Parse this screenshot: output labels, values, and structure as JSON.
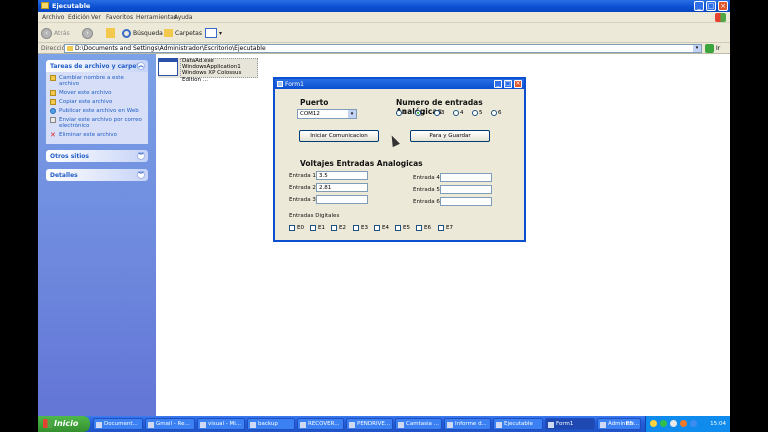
{
  "window": {
    "title": "Ejecutable"
  },
  "menu": [
    "Archivo",
    "Edición",
    "Ver",
    "Favoritos",
    "Herramientas",
    "Ayuda"
  ],
  "toolbar": {
    "back": "Atrás",
    "search": "Búsqueda",
    "folders": "Carpetas"
  },
  "address": {
    "label": "Dirección",
    "value": "D:\\Documents and Settings\\Administrador\\Escritorio\\Ejecutable",
    "go": "Ir"
  },
  "sidebar": {
    "tasks": {
      "title": "Tareas de archivo y carpeta",
      "items": [
        {
          "label": "Cambiar nombre a este archivo",
          "icon": "rename-icon"
        },
        {
          "label": "Mover este archivo",
          "icon": "move-icon"
        },
        {
          "label": "Copiar este archivo",
          "icon": "copy-icon"
        },
        {
          "label": "Publicar este archivo en Web",
          "icon": "web-icon"
        },
        {
          "label": "Enviar este archivo por correo electrónico",
          "icon": "mail-icon"
        },
        {
          "label": "Eliminar este archivo",
          "icon": "delete-icon"
        }
      ]
    },
    "other": {
      "title": "Otros sitios"
    },
    "details": {
      "title": "Detalles"
    }
  },
  "file": {
    "name": "DataAd.exe",
    "desc": "WindowsApplication1",
    "company": "Windows XP Colossus Edition ..."
  },
  "form": {
    "title": "Form1",
    "port_label": "Puerto",
    "port_value": "COM12",
    "analog_label": "Numero de entradas Analógicas",
    "radios": [
      "1",
      "2",
      "3",
      "4",
      "5",
      "6"
    ],
    "radio_selected": "2",
    "start_button": "Iniciar Comunicacion",
    "stop_button": "Para y Guardar",
    "voltages_label": "Voltajes Entradas Analogicas",
    "inputs": [
      {
        "label": "Entrada 1",
        "value": "3.5"
      },
      {
        "label": "Entrada 2",
        "value": "2.81"
      },
      {
        "label": "Entrada 3",
        "value": ""
      },
      {
        "label": "Entrada 4",
        "value": ""
      },
      {
        "label": "Entrada 5",
        "value": ""
      },
      {
        "label": "Entrada 6",
        "value": ""
      }
    ],
    "digital_label": "Entradas Digitales",
    "digital": [
      "E0",
      "E1",
      "E2",
      "E3",
      "E4",
      "E5",
      "E6",
      "E7"
    ]
  },
  "taskbar": {
    "start": "Inicio",
    "tasks": [
      "Document...",
      "Gmail - Re...",
      "visual - Mi...",
      "backup",
      "RECOVER...",
      "PENDRIVE...",
      "Camtasia ...",
      "Informe d...",
      "Ejecutable",
      "Form1",
      "Administr..."
    ],
    "active": "Form1",
    "lang": "ES",
    "clock": "15:04"
  }
}
